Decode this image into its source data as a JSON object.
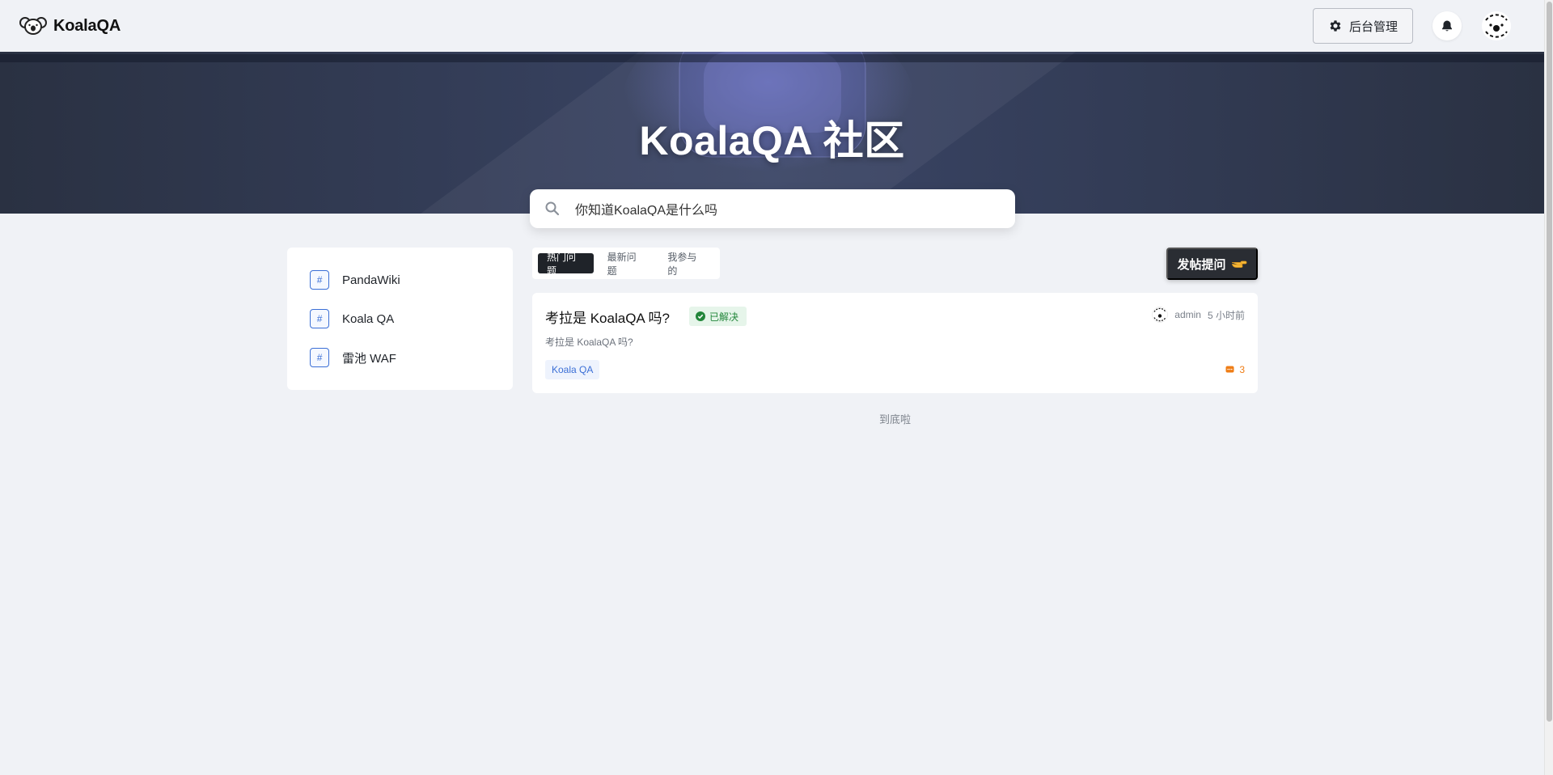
{
  "header": {
    "brand": "KoalaQA",
    "admin_label": "后台管理"
  },
  "hero": {
    "title": "KoalaQA 社区"
  },
  "search": {
    "value": "你知道KoalaQA是什么吗",
    "placeholder": "你知道KoalaQA是什么吗"
  },
  "categories": [
    {
      "icon": "#",
      "label": "PandaWiki"
    },
    {
      "icon": "#",
      "label": "Koala QA"
    },
    {
      "icon": "#",
      "label": "雷池 WAF"
    }
  ],
  "tabs": [
    {
      "label": "热门问题",
      "active": true
    },
    {
      "label": "最新问题",
      "active": false
    },
    {
      "label": "我参与的",
      "active": false
    }
  ],
  "post_button": {
    "label": "发帖提问"
  },
  "questions": [
    {
      "title": "考拉是 KoalaQA 吗?",
      "status": "已解决",
      "author": "admin",
      "time": "5 小时前",
      "summary": "考拉是 KoalaQA 吗?",
      "tag": "Koala QA",
      "comments": "3"
    }
  ],
  "list_end": "到底啦",
  "colors": {
    "accent": "#3b6fd6",
    "solved": "#22863a",
    "comments": "#ef7d16",
    "dark_button": "#2a2d33"
  }
}
